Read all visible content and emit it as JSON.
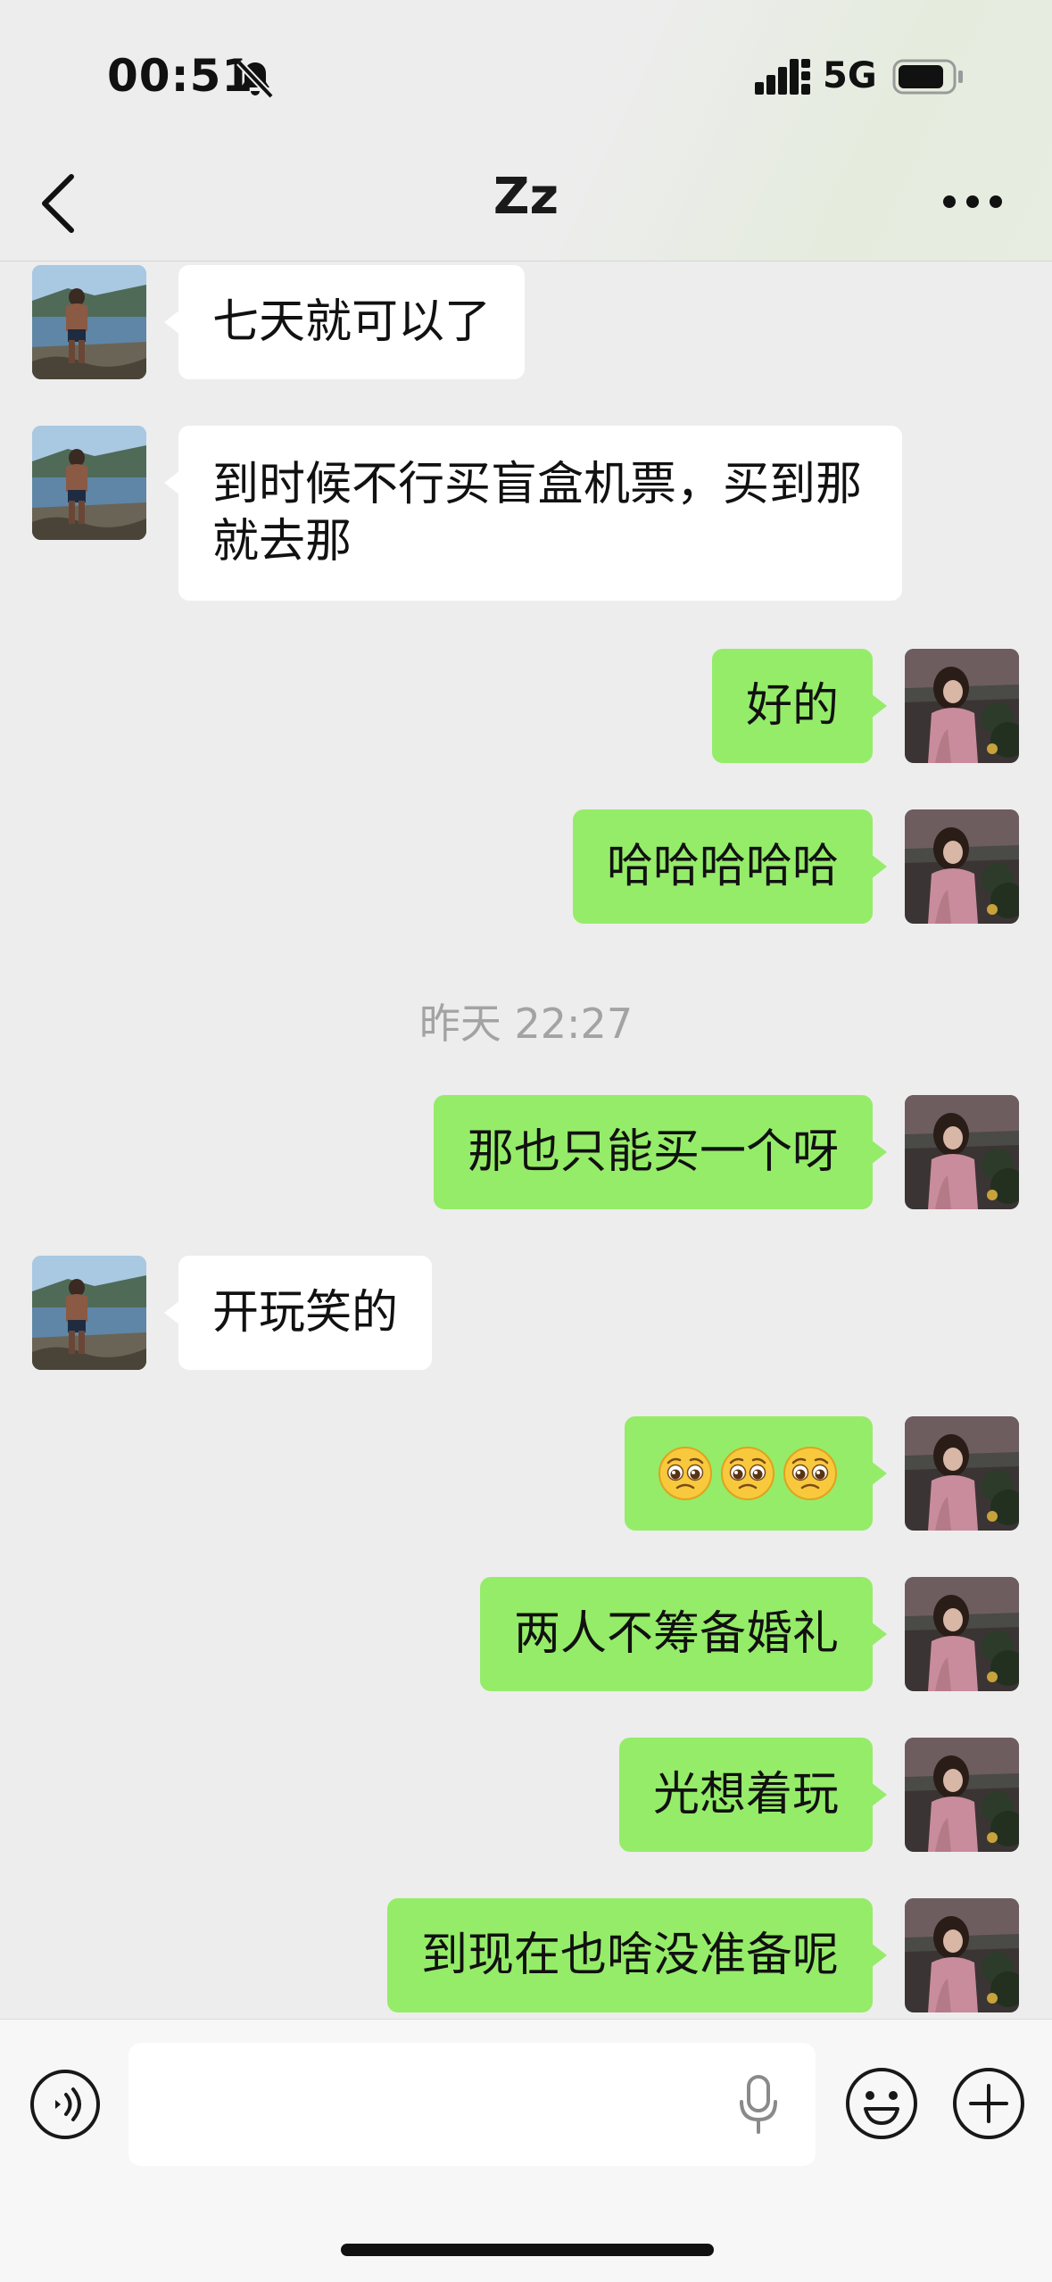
{
  "status_bar": {
    "time": "00:51",
    "network": "5G",
    "icons": [
      "bell-off-icon",
      "signal-icon",
      "battery-icon"
    ]
  },
  "nav": {
    "title": "Zz",
    "back_icon": "chevron-left-icon",
    "more_icon": "more-icon"
  },
  "messages": [
    {
      "side": "left",
      "text": "七天就可以了"
    },
    {
      "side": "left",
      "text": "到时候不行买盲盒机票，买到那就去那"
    },
    {
      "side": "right",
      "text": "好的"
    },
    {
      "side": "right",
      "text": "哈哈哈哈哈"
    },
    {
      "side": "timestamp",
      "text": "昨天 22:27"
    },
    {
      "side": "right",
      "text": "那也只能买一个呀"
    },
    {
      "side": "left",
      "text": "开玩笑的"
    },
    {
      "side": "right",
      "text": "🥺🥺🥺",
      "emoji": [
        "pleading-face-emoji",
        "pleading-face-emoji",
        "pleading-face-emoji"
      ]
    },
    {
      "side": "right",
      "text": "两人不筹备婚礼"
    },
    {
      "side": "right",
      "text": "光想着玩"
    },
    {
      "side": "right",
      "text": "到现在也啥没准备呢"
    }
  ],
  "input_bar": {
    "value": "",
    "icons": [
      "voice-icon",
      "microphone-icon",
      "emoji-icon",
      "plus-icon"
    ]
  },
  "colors": {
    "background": "#ededed",
    "bubble_self": "#95ec69",
    "bubble_other": "#ffffff",
    "timestamp": "#a3a3a3"
  }
}
